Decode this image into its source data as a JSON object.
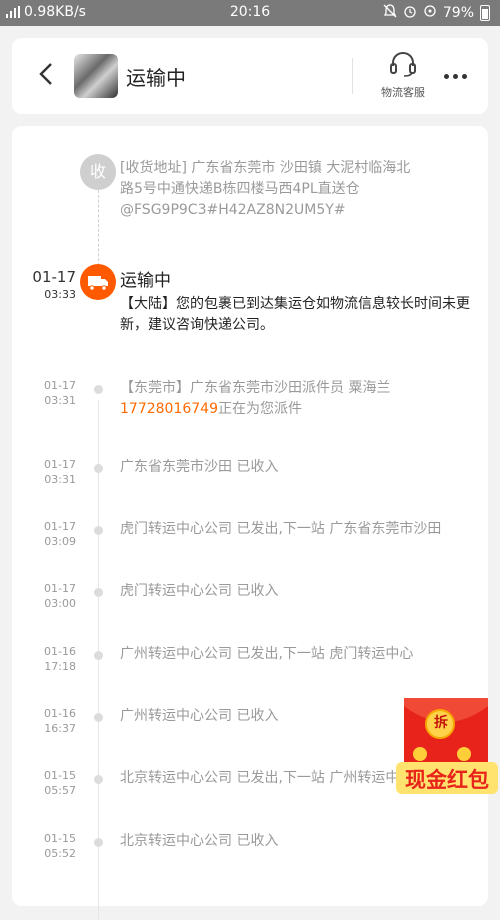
{
  "status_bar": {
    "net_speed": "0.98KB/s",
    "time": "20:16",
    "battery": "79%"
  },
  "header": {
    "title": "运输中",
    "service_label": "物流客服"
  },
  "receiver": {
    "icon_text": "收",
    "address": "[收货地址] 广东省东莞市 沙田镇 大泥村临海北路5号中通快递B栋四楼马西4PL直送仓@FSG9P9C3#H42AZ8N2UM5Y#"
  },
  "current": {
    "date": "01-17",
    "time": "03:33",
    "status": "运输中",
    "desc": "【大陆】您的包裹已到达集运仓如物流信息较长时间未更新，建议咨询快递公司。"
  },
  "events": [
    {
      "date": "01-17",
      "time": "03:31",
      "desc_before": "【东莞市】广东省东莞市沙田派件员 粟海兰",
      "phone": "17728016749",
      "desc_after": "正在为您派件"
    },
    {
      "date": "01-17",
      "time": "03:31",
      "desc": "广东省东莞市沙田 已收入"
    },
    {
      "date": "01-17",
      "time": "03:09",
      "desc": "虎门转运中心公司 已发出,下一站 广东省东莞市沙田"
    },
    {
      "date": "01-17",
      "time": "03:00",
      "desc": "虎门转运中心公司 已收入"
    },
    {
      "date": "01-16",
      "time": "17:18",
      "desc": "广州转运中心公司 已发出,下一站 虎门转运中心"
    },
    {
      "date": "01-16",
      "time": "16:37",
      "desc": "广州转运中心公司 已收入"
    },
    {
      "date": "01-15",
      "time": "05:57",
      "desc": "北京转运中心公司 已发出,下一站 广州转运中心"
    },
    {
      "date": "01-15",
      "time": "05:52",
      "desc": "北京转运中心公司 已收入"
    }
  ],
  "red_packet": {
    "chai": "拆",
    "label": "现金红包"
  },
  "colors": {
    "accent": "#ff5a00",
    "phone": "#ff6a00",
    "muted_text": "#9a9a9a"
  }
}
